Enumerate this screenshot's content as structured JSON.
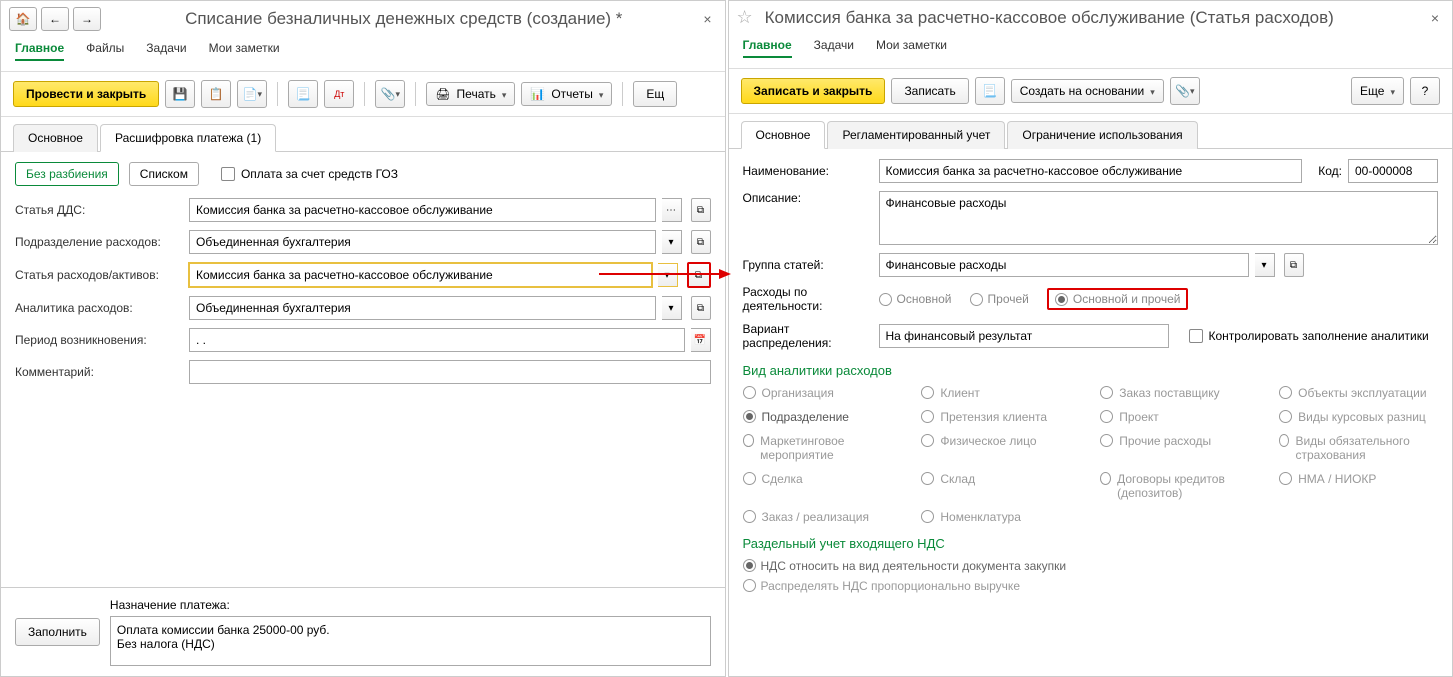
{
  "left": {
    "title": "Списание безналичных денежных средств (создание) *",
    "menu": [
      "Главное",
      "Файлы",
      "Задачи",
      "Мои заметки"
    ],
    "toolbar": {
      "post_close": "Провести и закрыть",
      "print": "Печать",
      "reports": "Отчеты",
      "more": "Ещ"
    },
    "tabs": [
      "Основное",
      "Расшифровка платежа (1)"
    ],
    "mode": {
      "no_split": "Без разбиения",
      "list": "Списком"
    },
    "goz_checkbox": "Оплата за счет средств ГОЗ",
    "fields": {
      "dds_label": "Статья ДДС:",
      "dds_value": "Комиссия банка за расчетно-кассовое обслуживание",
      "dept_label": "Подразделение расходов:",
      "dept_value": "Объединенная бухгалтерия",
      "exp_label": "Статья расходов/активов:",
      "exp_value": "Комиссия банка за расчетно-кассовое обслуживание",
      "analytics_label": "Аналитика расходов:",
      "analytics_value": "Объединенная бухгалтерия",
      "period_label": "Период возникновения:",
      "period_value": ".   .",
      "comment_label": "Комментарий:"
    },
    "bottom": {
      "fill_btn": "Заполнить",
      "purpose_label": "Назначение платежа:",
      "purpose_text": "Оплата комиссии банка 25000-00 руб.\nБез налога (НДС)"
    }
  },
  "right": {
    "title": "Комиссия банка за расчетно-кассовое обслуживание (Статья расходов)",
    "menu": [
      "Главное",
      "Задачи",
      "Мои заметки"
    ],
    "toolbar": {
      "save_close": "Записать и закрыть",
      "save": "Записать",
      "create_based": "Создать на основании",
      "more": "Еще"
    },
    "tabs": [
      "Основное",
      "Регламентированный учет",
      "Ограничение использования"
    ],
    "fields": {
      "name_label": "Наименование:",
      "name_value": "Комиссия банка за расчетно-кассовое обслуживание",
      "code_label": "Код:",
      "code_value": "00-000008",
      "desc_label": "Описание:",
      "desc_value": "Финансовые расходы",
      "group_label": "Группа статей:",
      "group_value": "Финансовые расходы",
      "activity_label": "Расходы по деятельности:",
      "activity_opts": [
        "Основной",
        "Прочей",
        "Основной и прочей"
      ],
      "dist_label": "Вариант распределения:",
      "dist_value": "На финансовый результат",
      "control_checkbox": "Контролировать заполнение аналитики"
    },
    "analytics_title": "Вид аналитики расходов",
    "analytics": [
      "Организация",
      "Клиент",
      "Заказ поставщику",
      "Объекты эксплуатации",
      "Подразделение",
      "Претензия клиента",
      "Проект",
      "Виды курсовых разниц",
      "Маркетинговое мероприятие",
      "Физическое лицо",
      "Прочие расходы",
      "Виды обязательного страхования",
      "Сделка",
      "Склад",
      "Договоры кредитов (депозитов)",
      "НМА / НИОКР",
      "Заказ / реализация",
      "Номенклатура"
    ],
    "vat_title": "Раздельный учет входящего НДС",
    "vat_opts": [
      "НДС относить на вид деятельности документа закупки",
      "Распределять НДС пропорционально выручке"
    ]
  }
}
